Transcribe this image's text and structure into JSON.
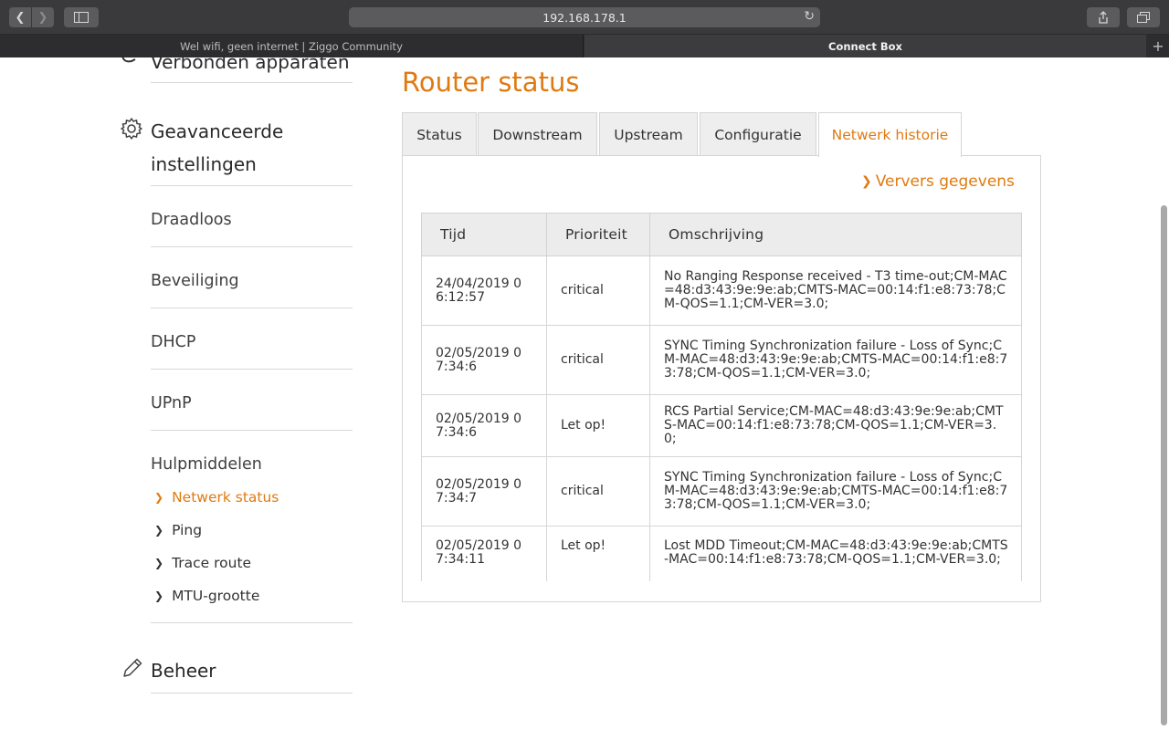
{
  "browser": {
    "url": "192.168.178.1",
    "tabs": [
      {
        "label": "Wel wifi, geen internet | Ziggo Community"
      },
      {
        "label": "Connect Box"
      }
    ],
    "new_tab_glyph": "+"
  },
  "sidebar": {
    "connected_devices": "Verbonden apparaten",
    "advanced_line1": "Geavanceerde",
    "advanced_line2": "instellingen",
    "items": [
      {
        "label": "Draadloos"
      },
      {
        "label": "Beveiliging"
      },
      {
        "label": "DHCP"
      },
      {
        "label": "UPnP"
      },
      {
        "label": "Hulpmiddelen"
      }
    ],
    "tools": [
      {
        "label": "Netwerk status",
        "active": true
      },
      {
        "label": "Ping"
      },
      {
        "label": "Trace route"
      },
      {
        "label": "MTU-grootte"
      }
    ],
    "management": "Beheer"
  },
  "main": {
    "title": "Router status",
    "tabs": [
      {
        "label": "Status"
      },
      {
        "label": "Downstream"
      },
      {
        "label": "Upstream"
      },
      {
        "label": "Configuratie"
      },
      {
        "label": "Netwerk historie",
        "active": true
      }
    ],
    "refresh_label": "Ververs gegevens",
    "table": {
      "headers": [
        "Tijd",
        "Prioriteit",
        "Omschrijving"
      ],
      "rows": [
        {
          "time": "24/04/2019 06:12:57",
          "priority": "critical",
          "description": "No Ranging Response received - T3 time-out;CM-MAC=48:d3:43:9e:9e:ab;CMTS-MAC=00:14:f1:e8:73:78;CM-QOS=1.1;CM-VER=3.0;"
        },
        {
          "time": "02/05/2019 07:34:6",
          "priority": "critical",
          "description": "SYNC Timing Synchronization failure - Loss of Sync;CM-MAC=48:d3:43:9e:9e:ab;CMTS-MAC=00:14:f1:e8:73:78;CM-QOS=1.1;CM-VER=3.0;"
        },
        {
          "time": "02/05/2019 07:34:6",
          "priority": "Let op!",
          "description": "RCS Partial Service;CM-MAC=48:d3:43:9e:9e:ab;CMTS-MAC=00:14:f1:e8:73:78;CM-QOS=1.1;CM-VER=3.0;"
        },
        {
          "time": "02/05/2019 07:34:7",
          "priority": "critical",
          "description": "SYNC Timing Synchronization failure - Loss of Sync;CM-MAC=48:d3:43:9e:9e:ab;CMTS-MAC=00:14:f1:e8:73:78;CM-QOS=1.1;CM-VER=3.0;"
        },
        {
          "time": "02/05/2019 07:34:11",
          "priority": "Let op!",
          "description": "Lost MDD Timeout;CM-MAC=48:d3:43:9e:9e:ab;CMTS-MAC=00:14:f1:e8:73:78;CM-QOS=1.1;CM-VER=3.0;"
        }
      ]
    }
  },
  "colors": {
    "accent": "#e07a10",
    "text": "#333333",
    "header_bg": "#ececec"
  }
}
